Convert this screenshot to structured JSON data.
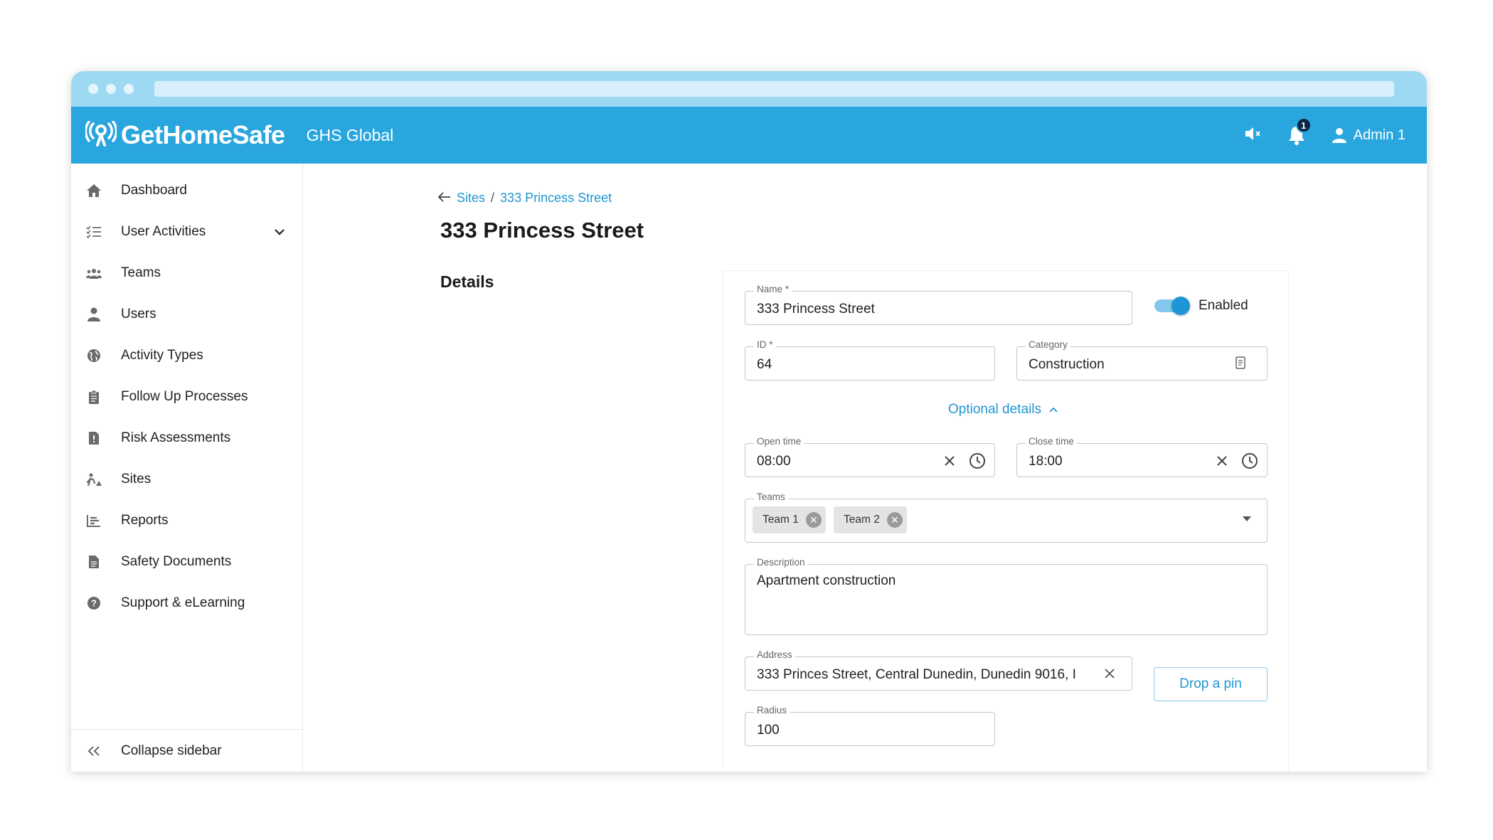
{
  "app": {
    "brand": "GetHomeSafe",
    "org": "GHS Global"
  },
  "topbar": {
    "notification_count": "1",
    "user_name": "Admin 1"
  },
  "sidebar": {
    "items": [
      {
        "label": "Dashboard",
        "icon": "home-icon"
      },
      {
        "label": "User Activities",
        "icon": "checklist-icon"
      },
      {
        "label": "Teams",
        "icon": "group-icon"
      },
      {
        "label": "Users",
        "icon": "person-icon"
      },
      {
        "label": "Activity Types",
        "icon": "globe-icon"
      },
      {
        "label": "Follow Up Processes",
        "icon": "clipboard-icon"
      },
      {
        "label": "Risk Assessments",
        "icon": "alert-document-icon"
      },
      {
        "label": "Sites",
        "icon": "construction-icon"
      },
      {
        "label": "Reports",
        "icon": "bar-chart-icon"
      },
      {
        "label": "Safety Documents",
        "icon": "document-icon"
      },
      {
        "label": "Support & eLearning",
        "icon": "help-icon"
      }
    ],
    "collapse_label": "Collapse sidebar"
  },
  "breadcrumb": {
    "parent": "Sites",
    "separator": "/",
    "current": "333 Princess Street"
  },
  "page": {
    "title": "333 Princess Street",
    "section": "Details"
  },
  "form": {
    "name": {
      "label": "Name *",
      "value": "333 Princess Street"
    },
    "enabled": {
      "label": "Enabled",
      "on": true
    },
    "id": {
      "label": "ID *",
      "value": "64"
    },
    "category": {
      "label": "Category",
      "value": "Construction"
    },
    "optional_toggle": "Optional details",
    "open_time": {
      "label": "Open time",
      "value": "08:00"
    },
    "close_time": {
      "label": "Close time",
      "value": "18:00"
    },
    "teams": {
      "label": "Teams",
      "chips": [
        "Team 1",
        "Team 2"
      ]
    },
    "description": {
      "label": "Description",
      "value": "Apartment construction"
    },
    "address": {
      "label": "Address",
      "value": "333 Princes Street, Central Dunedin, Dunedin 9016, I"
    },
    "drop_pin": "Drop a pin",
    "radius": {
      "label": "Radius",
      "value": "100"
    }
  },
  "colors": {
    "header": "#29a6de",
    "accent": "#2196d3",
    "chrome": "#9ed9f3"
  }
}
